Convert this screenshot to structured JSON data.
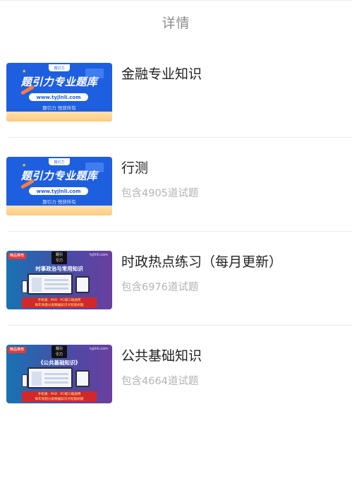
{
  "header": {
    "title": "详情"
  },
  "thumbnails": {
    "blue": {
      "brand": "题引力专业题库",
      "url": "www.tyjlnli.com",
      "sub": "题引力 悦获所有",
      "tag": "题引力"
    },
    "gradient": {
      "badge": "精品推荐",
      "site": "tyjlnli.com",
      "logo_line1": "题引",
      "logo_line2": "引力",
      "band_line1": "手机端 · PAD · PC端三端通用",
      "band_line2": "每年真题分类精编知识点智能刷题"
    }
  },
  "items": [
    {
      "name": "金融专业知识",
      "count": "",
      "thumb": "blue",
      "caption": ""
    },
    {
      "name": "行测",
      "count": "包含4905道试题",
      "thumb": "blue",
      "caption": ""
    },
    {
      "name": "时政热点练习（每月更新）",
      "count": "包含6976道试题",
      "thumb": "gradient",
      "caption": "时事政治与常用知识"
    },
    {
      "name": "公共基础知识",
      "count": "包含4664道试题",
      "thumb": "gradient",
      "caption": "《公共基础知识》"
    }
  ]
}
